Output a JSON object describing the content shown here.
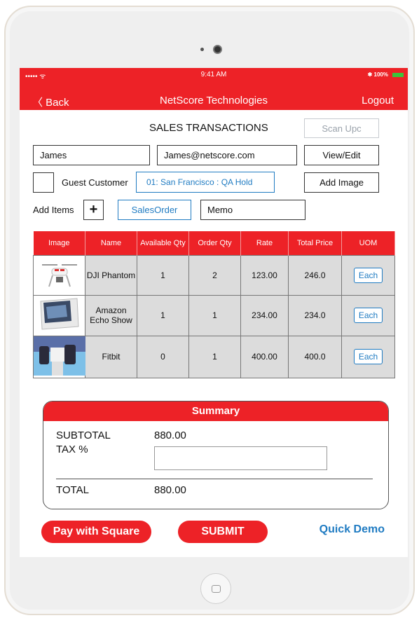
{
  "status_bar": {
    "signal": "••••• ᯤ",
    "time": "9:41 AM",
    "battery": "✱ 100%",
    "battery_color": "#3bc43b"
  },
  "nav": {
    "back": "〈 Back",
    "title": "NetScore Technologies",
    "logout": "Logout"
  },
  "page_title": "SALES TRANSACTIONS",
  "scan_upc": "Scan Upc",
  "customer": {
    "name": "James",
    "email": "James@netscore.com",
    "view_edit": "View/Edit"
  },
  "guest_label": "Guest Customer",
  "location": "01: San Francisco : QA Hold",
  "add_image": "Add Image",
  "add_items_label": "Add Items",
  "add_icon": "+",
  "order_type": "SalesOrder",
  "memo": "Memo",
  "table": {
    "headers": [
      "Image",
      "Name",
      "Available Qty",
      "Order Qty",
      "Rate",
      "Total Price",
      "UOM"
    ],
    "rows": [
      {
        "name": "DJI Phantom",
        "available": "1",
        "order": "2",
        "rate": "123.00",
        "total": "246.0",
        "uom": "Each"
      },
      {
        "name": "Amazon Echo Show",
        "available": "1",
        "order": "1",
        "rate": "234.00",
        "total": "234.0",
        "uom": "Each"
      },
      {
        "name": "Fitbit",
        "available": "0",
        "order": "1",
        "rate": "400.00",
        "total": "400.0",
        "uom": "Each"
      }
    ]
  },
  "summary": {
    "title": "Summary",
    "subtotal_label": "SUBTOTAL",
    "subtotal": "880.00",
    "tax_label": "TAX %",
    "tax_value": "",
    "total_label": "TOTAL",
    "total": "880.00"
  },
  "actions": {
    "pay": "Pay with Square",
    "submit": "SUBMIT",
    "demo": "Quick Demo"
  },
  "colors": {
    "accent": "#ed2227",
    "link": "#1f7bc2"
  }
}
